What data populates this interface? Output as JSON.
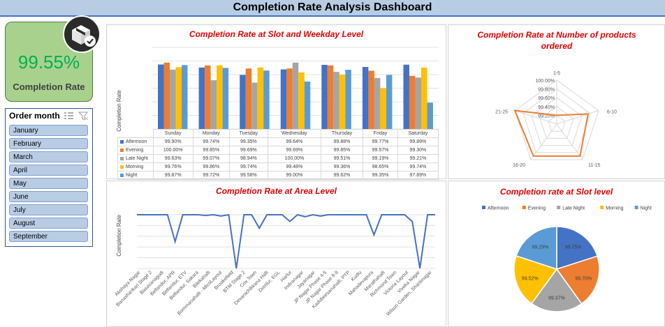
{
  "header": {
    "title": "Completion Rate Analysis Dashboard"
  },
  "kpi": {
    "value": "99.55%",
    "label": "Completion Rate",
    "icon": "delivery-box-check-icon"
  },
  "slicer": {
    "title": "Order month",
    "items": [
      "January",
      "February",
      "March",
      "April",
      "May",
      "June",
      "July",
      "August",
      "September"
    ]
  },
  "colors": {
    "afternoon": "#4472c4",
    "evening": "#ed7d31",
    "late_night": "#a5a5a5",
    "morning": "#ffc000",
    "night": "#5b9bd5",
    "area_line": "#4472c4",
    "title_red": "#e00000"
  },
  "chart_data": [
    {
      "type": "bar",
      "title": "Completion Rate at Slot and Weekday Level",
      "xlabel": "",
      "ylabel": "Completion Rate",
      "categories": [
        "Sunday",
        "Monday",
        "Tuesday",
        "Wednesday",
        "Thursday",
        "Friday",
        "Saturday"
      ],
      "series": [
        {
          "name": "Afternoon",
          "values": [
            99.9,
            99.74,
            99.35,
            99.64,
            99.88,
            99.77,
            99.89
          ],
          "labels": [
            "99.90%",
            "99.74%",
            "99.35%",
            "99.64%",
            "99.88%",
            "99.77%",
            "99.89%"
          ]
        },
        {
          "name": "Evening",
          "values": [
            100.0,
            99.85,
            99.69,
            99.69,
            99.85,
            99.57,
            99.3
          ],
          "labels": [
            "100.00%",
            "99.85%",
            "99.69%",
            "99.69%",
            "99.85%",
            "99.57%",
            "99.30%"
          ]
        },
        {
          "name": "Late Night",
          "values": [
            99.63,
            99.07,
            98.94,
            100.0,
            99.51,
            99.19,
            99.21
          ],
          "labels": [
            "99.63%",
            "99.07%",
            "98.94%",
            "100.00%",
            "99.51%",
            "99.19%",
            "99.21%"
          ]
        },
        {
          "name": "Morning",
          "values": [
            99.76,
            99.86,
            99.74,
            99.48,
            99.36,
            98.65,
            99.74
          ],
          "labels": [
            "99.76%",
            "99.86%",
            "99.74%",
            "99.48%",
            "99.36%",
            "98.65%",
            "99.74%"
          ]
        },
        {
          "name": "Night",
          "values": [
            99.87,
            99.72,
            99.58,
            99.0,
            99.62,
            99.35,
            97.89
          ],
          "labels": [
            "99.87%",
            "99.72%",
            "99.58%",
            "99.00%",
            "99.62%",
            "99.35%",
            "97.89%"
          ]
        }
      ],
      "grid": true,
      "legend": "data-table"
    },
    {
      "type": "radar",
      "title": "Completion Rate at Number of products ordered",
      "categories": [
        "1-5",
        "6-10",
        "11-15",
        "16-20",
        "21-25"
      ],
      "ticks": [
        "99.20%",
        "99.40%",
        "99.60%",
        "99.80%",
        "100.00%"
      ],
      "range": [
        99.0,
        100.0
      ],
      "values": [
        99.2,
        99.75,
        99.9,
        99.9,
        100.0
      ],
      "grid": true
    },
    {
      "type": "line",
      "title": "Completion Rate at Area Level",
      "xlabel": "",
      "ylabel": "Completion Rate",
      "categories": [
        "Akshaya Nagar",
        "Banashankari Stage 2",
        "Basavanagudi",
        "Bellandur, APR",
        "Bellandur, ETV",
        "Bellandur, Sakara",
        "Bilekahalli",
        "Bommanahalli - MicoLayout",
        "Brookefield",
        "BTM Stage 2",
        "Cox Town",
        "Devarachikkana Halli",
        "Domlur, EGL",
        "Harlur",
        "Indiranagar",
        "Jayanagar",
        "JP Nagar Phase 4-5",
        "JP Nagar Phase 8-9",
        "Kadubeesanahalli, PTP",
        "Kudlu",
        "Mahadevapura",
        "Marathahalli",
        "Richmond Town",
        "Victoria Layout",
        "Viveka Nagar",
        "Wilson Garden, Shantinagar"
      ],
      "values": [
        100.0,
        100.0,
        100.0,
        100.0,
        100.0,
        96.0,
        100.0,
        100.0,
        100.0,
        99.9,
        100.0,
        99.8,
        100.0,
        92.0,
        100.0,
        100.0,
        98.0,
        100.0,
        100.0,
        100.0,
        99.0,
        100.0,
        99.7,
        100.0,
        99.8,
        100.0,
        100.0,
        100.0,
        100.0,
        100.0,
        100.0,
        97.0,
        100.0,
        100.0,
        100.0,
        100.0,
        99.0,
        92.0,
        100.0,
        100.0
      ],
      "note_points": 40,
      "grid": true
    },
    {
      "type": "pie",
      "title": "Completion rate at Slot level",
      "categories": [
        "Afternoon",
        "Evening",
        "Late Night",
        "Morning",
        "Night"
      ],
      "values": [
        99.75,
        99.7,
        99.37,
        99.52,
        99.29
      ],
      "labels": [
        "99.75%",
        "99.70%",
        "99.37%",
        "99.52%",
        "99.29%"
      ],
      "legend": "top"
    }
  ]
}
